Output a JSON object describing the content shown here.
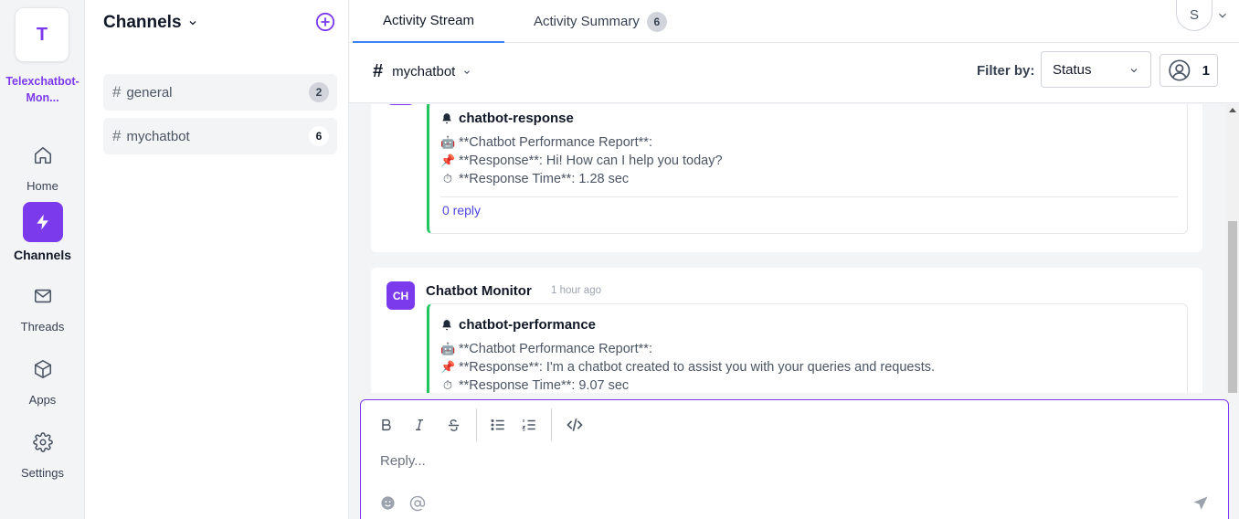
{
  "workspace": {
    "initial": "T",
    "name": "Telexchatbot-Mon..."
  },
  "rail": {
    "home": "Home",
    "channels": "Channels",
    "threads": "Threads",
    "apps": "Apps",
    "settings": "Settings"
  },
  "channels_panel": {
    "title": "Channels",
    "items": [
      {
        "name": "general",
        "count": "2"
      },
      {
        "name": "mychatbot",
        "count": "6"
      }
    ]
  },
  "tabs": {
    "stream": "Activity Stream",
    "summary": "Activity Summary",
    "summary_count": "6"
  },
  "user": {
    "initial": "S"
  },
  "subbar": {
    "channel": "mychatbot",
    "filter_label": "Filter by:",
    "filter_value": "Status",
    "member_count": "1"
  },
  "feed": {
    "msg1": {
      "title": "chatbot-response",
      "line1": "**Chatbot Performance Report**:",
      "line2": "**Response**: Hi! How can I help you today?",
      "line3": "**Response Time**: 1.28 sec",
      "reply": "0 reply"
    },
    "msg2": {
      "avatar": "CH",
      "author": "Chatbot Monitor",
      "time": "1 hour ago",
      "title": "chatbot-performance",
      "line1": "**Chatbot Performance Report**:",
      "line2": "**Response**: I'm a chatbot created to assist you with your queries and requests.",
      "line3": "**Response Time**: 9.07 sec"
    }
  },
  "editor": {
    "placeholder": "Reply..."
  },
  "colors": {
    "accent": "#7c3aed",
    "tab_underline": "#3b82f6",
    "message_bar": "#22c55e",
    "link": "#4f46e5"
  }
}
